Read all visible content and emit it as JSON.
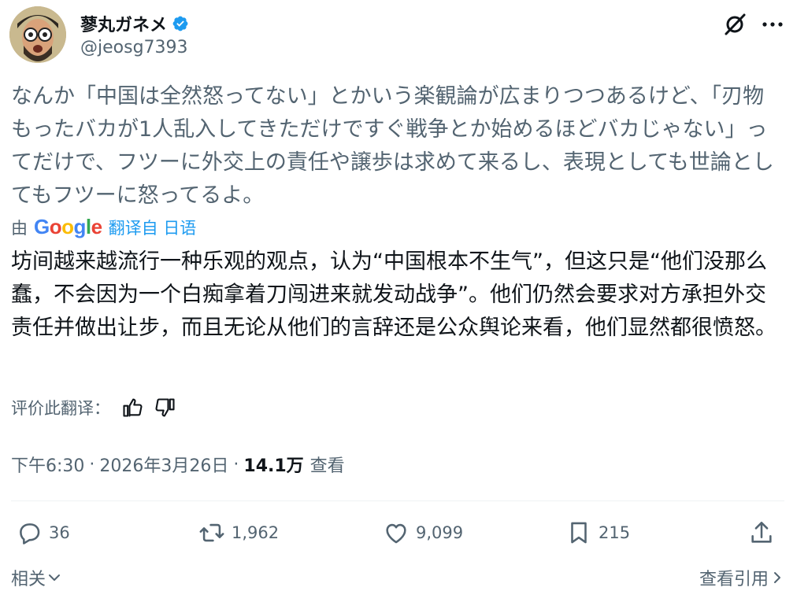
{
  "author": {
    "display_name": "蓼丸ガネメ",
    "handle": "@jeosg7393"
  },
  "post": {
    "original_text": "なんか「中国は全然怒ってない」とかいう楽観論が広まりつつあるけど、「刃物もったバカが1人乱入してきただけですぐ戦争とか始めるほどバカじゃない」ってだけで、フツーに外交上の責任や譲歩は求めて来るし、表現としても世論としてもフツーに怒ってるよ。",
    "translated_by_prefix": "由",
    "translated_by_brand": "Google",
    "translated_from": "翻译自 日语",
    "translated_text": "坊间越来越流行一种乐观的观点，认为“中国根本不生气”，但这只是“他们没那么蠢，不会因为一个白痴拿着刀闯进来就发动战争”。他们仍然会要求对方承担外交责任并做出让步，而且无论从他们的言辞还是公众舆论来看，他们显然都很愤怒。",
    "rate_translation_label": "评价此翻译：",
    "time": "下午6:30",
    "date": "2026年3月26日",
    "separator": "·",
    "views_count": "14.1万",
    "views_label": "查看"
  },
  "actions": {
    "replies": "36",
    "reposts": "1,962",
    "likes": "9,099",
    "bookmarks": "215"
  },
  "footer": {
    "related_label": "相关",
    "view_quotes_label": "查看引用"
  },
  "colors": {
    "text_primary": "#0f1419",
    "text_secondary": "#536471",
    "link": "#1d9bf0",
    "verified": "#1d9bf0"
  },
  "icons": [
    "avatar",
    "verified-badge-icon",
    "grok-icon",
    "more-icon",
    "thumbs-up-icon",
    "thumbs-down-icon",
    "reply-icon",
    "repost-icon",
    "like-icon",
    "bookmark-icon",
    "share-icon",
    "chevron-down-icon",
    "chevron-right-icon"
  ]
}
